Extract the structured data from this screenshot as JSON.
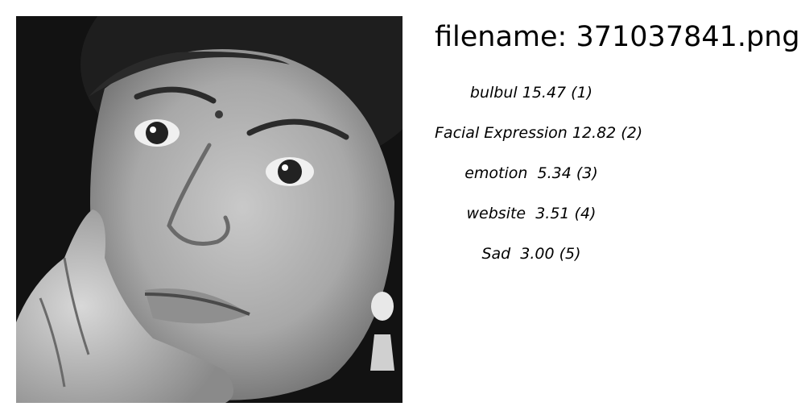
{
  "filename_line": "filename: 371037841.png",
  "image": {
    "icon": "grayscale-face-photo"
  },
  "labels": [
    {
      "text": "bulbul 15.47 (1)"
    },
    {
      "text": "Facial Expression 12.82 (2)"
    },
    {
      "text": "emotion  5.34 (3)"
    },
    {
      "text": "website  3.51 (4)"
    },
    {
      "text": "Sad  3.00 (5)"
    }
  ]
}
